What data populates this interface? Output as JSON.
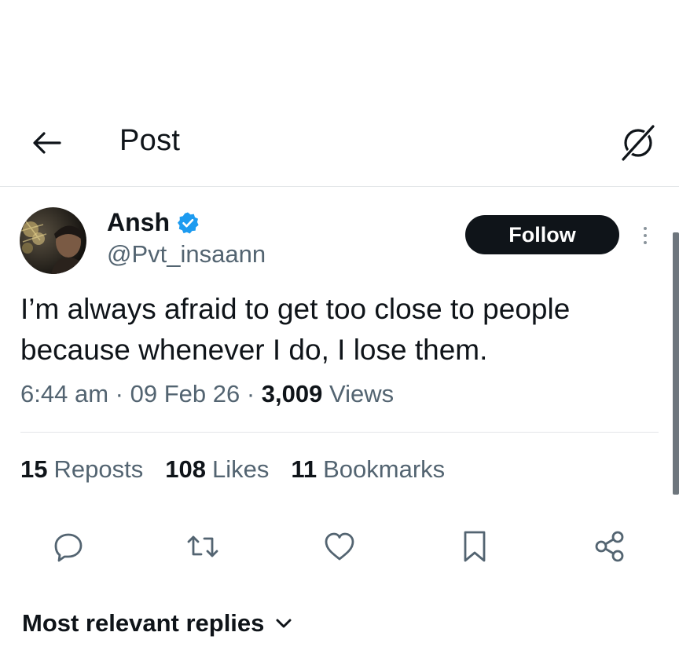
{
  "header": {
    "title": "Post",
    "back_icon": "arrow-left-icon",
    "grok_icon": "grok-slash-icon"
  },
  "author": {
    "name": "Ansh",
    "handle": "@Pvt_insaann",
    "verified": true,
    "verified_color": "#1d9bf0"
  },
  "follow_label": "Follow",
  "post": {
    "text": "I’m always afraid to get too close to people because whenever I do, I lose them."
  },
  "meta": {
    "time": "6:44 am",
    "sep1": "·",
    "date": "09 Feb 26",
    "sep2": "·",
    "views_count": "3,009",
    "views_label": "Views"
  },
  "stats": {
    "reposts": {
      "count": "15",
      "label": "Reposts"
    },
    "likes": {
      "count": "108",
      "label": "Likes"
    },
    "bookmarks": {
      "count": "11",
      "label": "Bookmarks"
    }
  },
  "actions": [
    "reply-icon",
    "repost-icon",
    "like-icon",
    "bookmark-icon",
    "share-icon"
  ],
  "replies_sort": {
    "label": "Most relevant replies"
  },
  "colors": {
    "text": "#0f1419",
    "secondary": "#536471",
    "icon": "#536471",
    "button_bg": "#0f1419",
    "divider": "#e3e6e8"
  }
}
